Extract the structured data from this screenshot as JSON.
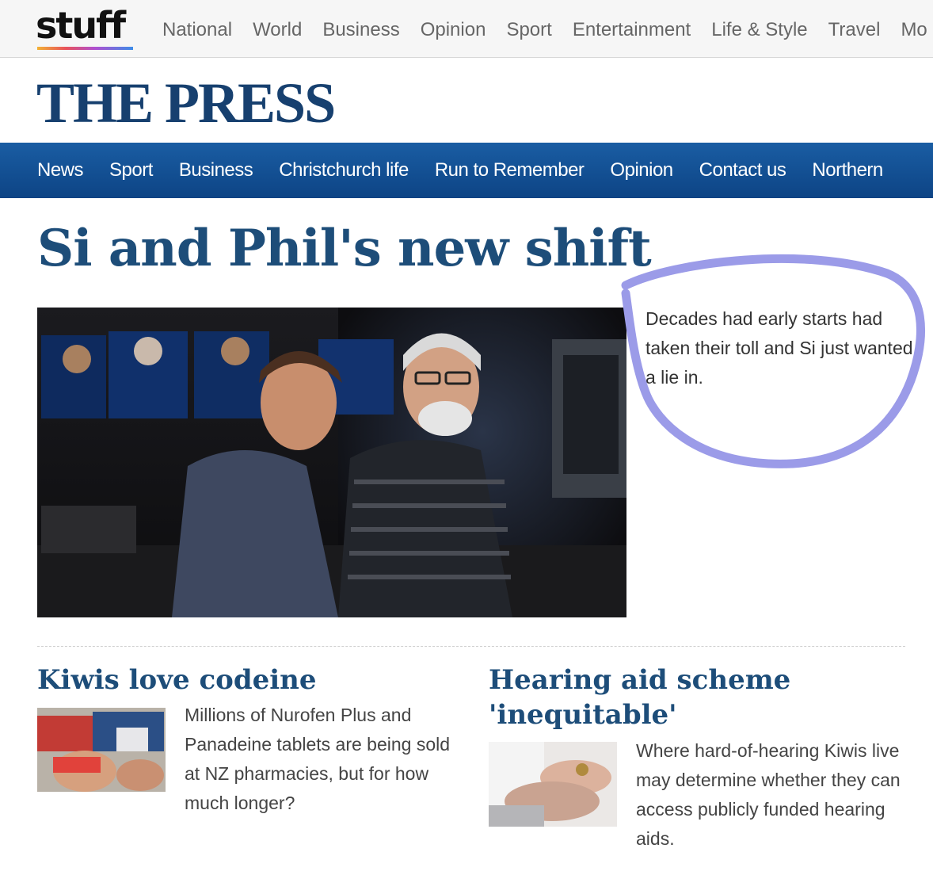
{
  "brand": {
    "logo_text": "stuff",
    "masthead": "THE PRESS"
  },
  "top_nav": [
    "National",
    "World",
    "Business",
    "Opinion",
    "Sport",
    "Entertainment",
    "Life & Style",
    "Travel",
    "Mo"
  ],
  "section_nav": [
    "News",
    "Sport",
    "Business",
    "Christchurch life",
    "Run to Remember",
    "Opinion",
    "Contact us",
    "Northern"
  ],
  "lead_story": {
    "headline": "Si and Phil's new shift",
    "summary": "Decades had early starts had taken their toll and Si just wanted a lie in.",
    "image_alt": "Si and Phil in radio studio"
  },
  "stories": [
    {
      "title": "Kiwis love codeine",
      "summary": "Millions of Nurofen Plus and Panadeine tablets are being sold at NZ pharmacies, but for how much longer?"
    },
    {
      "title": "Hearing aid scheme 'inequitable'",
      "summary": "Where hard-of-hearing Kiwis live may determine whether they can access publicly funded hearing aids."
    }
  ],
  "colors": {
    "masthead": "#17406f",
    "nav_blue": "#0d4485",
    "headline": "#1d4d79",
    "annotation": "#9b9be8"
  }
}
